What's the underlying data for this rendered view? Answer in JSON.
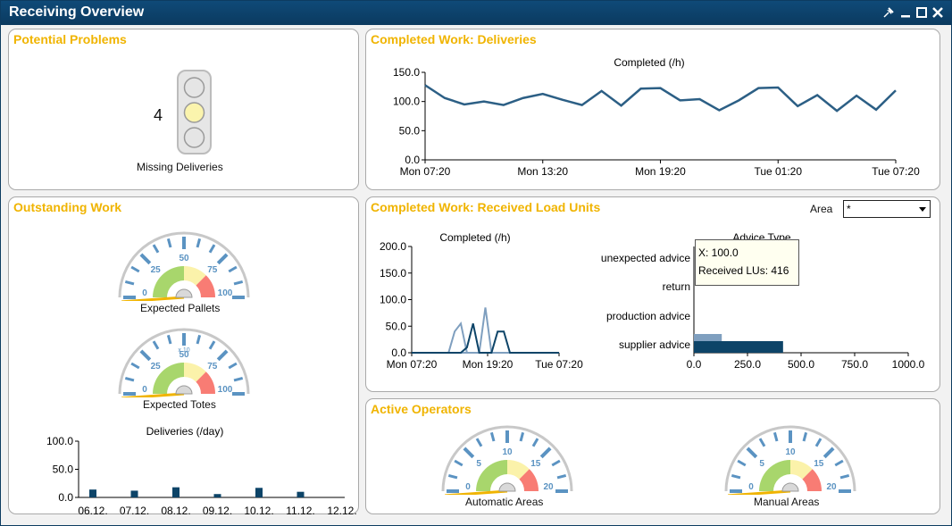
{
  "window": {
    "title": "Receiving Overview",
    "pin_icon": "pin-icon",
    "minimize_icon": "minimize-icon",
    "maximize_icon": "maximize-icon",
    "close_icon": "close-icon"
  },
  "colors": {
    "title_bar": "#0b3a5f",
    "panel_title": "#f0b400",
    "series_dark": "#0d4468",
    "series_light": "#7f9fbf",
    "line_main": "#2c5f85",
    "gauge_red": "#f87c74",
    "gauge_yellow": "#fbf2aa",
    "gauge_green": "#a8d66c",
    "gauge_ticks": "#5b93c2",
    "needle": "#f0b400"
  },
  "potential_problems": {
    "title": "Potential Problems",
    "count": "4",
    "label": "Missing Deliveries",
    "traffic_light_active": "yellow"
  },
  "deliveries_chart": {
    "title": "Completed Work: Deliveries",
    "chart_data": {
      "type": "line",
      "title": "Completed (/h)",
      "yticks": [
        "150.0",
        "100.0",
        "50.0",
        "0.0"
      ],
      "ylim": [
        0,
        150
      ],
      "xticks": [
        "Mon 07:20",
        "Mon 13:20",
        "Mon 19:20",
        "Tue 01:20",
        "Tue 07:20"
      ],
      "series": [
        {
          "values": [
            128,
            106,
            95,
            100,
            94,
            106,
            113,
            103,
            94,
            118,
            93,
            122,
            123,
            102,
            104,
            85,
            102,
            123,
            124,
            92,
            111,
            84,
            110,
            86,
            119
          ]
        }
      ]
    }
  },
  "outstanding_work": {
    "title": "Outstanding Work",
    "pallets_gauge": {
      "label": "Expected Pallets",
      "ticks": [
        "0",
        "25",
        "50",
        "75",
        "100"
      ],
      "value": 0,
      "max": 100
    },
    "totes_gauge": {
      "label": "Expected Totes",
      "ticks": [
        "0",
        "25",
        "50",
        "75",
        "100"
      ],
      "value": 0,
      "max": 100,
      "multiplier": "x 10"
    },
    "deliveries_per_day": {
      "chart_data": {
        "type": "bar",
        "title": "Deliveries (/day)",
        "yticks": [
          "100.0",
          "50.0",
          "0.0"
        ],
        "ylim": [
          0,
          100
        ],
        "categories": [
          "06.12.",
          "07.12.",
          "08.12.",
          "09.12.",
          "10.12.",
          "11.12.",
          "12.12."
        ],
        "values": [
          14,
          12,
          18,
          6,
          17,
          10,
          0
        ]
      }
    }
  },
  "received_lus": {
    "title": "Completed Work: Received Load Units",
    "area_label": "Area",
    "area_value": "*",
    "completed_chart": {
      "chart_data": {
        "type": "line",
        "title": "Completed (/h)",
        "yticks": [
          "200.0",
          "150.0",
          "100.0",
          "50.0",
          "0.0"
        ],
        "ylim": [
          0,
          200
        ],
        "xticks": [
          "Mon 07:20",
          "Mon 19:20",
          "Tue 07:20"
        ],
        "series": [
          {
            "values": [
              0,
              0,
              0,
              0,
              0,
              0,
              0,
              0,
              0,
              0,
              0,
              0,
              0,
              0,
              0,
              0,
              0,
              0,
              0,
              0,
              0,
              0,
              0,
              0,
              0
            ]
          },
          {
            "values": [
              0,
              0,
              0,
              0,
              0,
              0,
              0,
              40,
              55,
              0,
              0,
              0,
              85,
              0,
              0,
              0,
              0,
              0,
              0,
              0,
              0,
              0,
              0,
              0,
              0
            ]
          },
          {
            "values": [
              0,
              0,
              0,
              0,
              0,
              0,
              0,
              0,
              0,
              10,
              55,
              0,
              0,
              0,
              40,
              40,
              0,
              0,
              0,
              0,
              0,
              0,
              0,
              0,
              0
            ]
          }
        ]
      }
    },
    "advice_chart": {
      "chart_data": {
        "type": "bar",
        "title": "Advice Type",
        "categories": [
          "unexpected advice",
          "return",
          "production advice",
          "supplier advice"
        ],
        "xticks": [
          "0.0",
          "250.0",
          "500.0",
          "750.0",
          "1000.0"
        ],
        "xlim": [
          0,
          1000
        ],
        "series": [
          {
            "values": [
              0,
              0,
              0,
              130
            ]
          },
          {
            "values": [
              0,
              0,
              0,
              416
            ]
          }
        ]
      },
      "tooltip": {
        "line1": "X: 100.0",
        "line2": "Received LUs: 416"
      }
    }
  },
  "active_operators": {
    "title": "Active Operators",
    "automatic_gauge": {
      "label": "Automatic Areas",
      "ticks": [
        "0",
        "5",
        "10",
        "15",
        "20"
      ],
      "value": 0,
      "max": 20
    },
    "manual_gauge": {
      "label": "Manual Areas",
      "ticks": [
        "0",
        "5",
        "10",
        "15",
        "20"
      ],
      "value": 0,
      "max": 20
    }
  }
}
